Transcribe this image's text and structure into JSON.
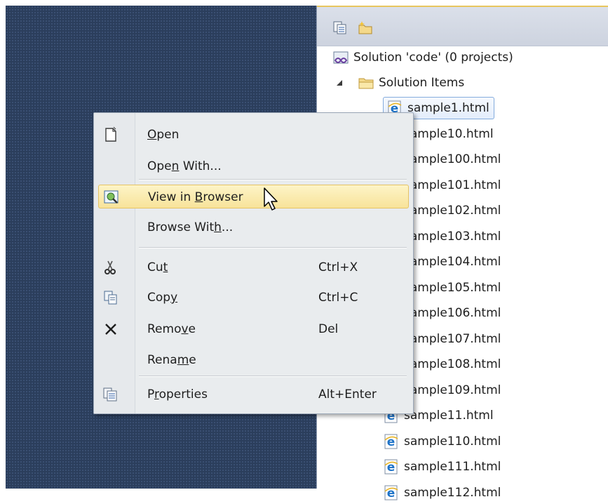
{
  "solution_explorer": {
    "solution_label": "Solution 'code' (0 projects)",
    "folder_label": "Solution Items",
    "files": [
      "sample1.html",
      "sample10.html",
      "sample100.html",
      "sample101.html",
      "sample102.html",
      "sample103.html",
      "sample104.html",
      "sample105.html",
      "sample106.html",
      "sample107.html",
      "sample108.html",
      "sample109.html",
      "sample11.html",
      "sample110.html",
      "sample111.html",
      "sample112.html"
    ]
  },
  "context_menu": {
    "items": [
      {
        "pre": "",
        "acc": "O",
        "post": "pen",
        "shortcut": "",
        "icon": "open-file-icon"
      },
      {
        "pre": "Ope",
        "acc": "n",
        "post": " With...",
        "shortcut": "",
        "icon": ""
      },
      {
        "pre": "View in ",
        "acc": "B",
        "post": "rowser",
        "shortcut": "",
        "icon": "view-in-browser-icon"
      },
      {
        "pre": "Browse Wit",
        "acc": "h",
        "post": "...",
        "shortcut": "",
        "icon": ""
      },
      {
        "pre": "Cu",
        "acc": "t",
        "post": "",
        "shortcut": "Ctrl+X",
        "icon": "scissors-icon"
      },
      {
        "pre": "Cop",
        "acc": "y",
        "post": "",
        "shortcut": "Ctrl+C",
        "icon": "copy-icon"
      },
      {
        "pre": "Remo",
        "acc": "v",
        "post": "e",
        "shortcut": "Del",
        "icon": "remove-icon"
      },
      {
        "pre": "Rena",
        "acc": "m",
        "post": "e",
        "shortcut": "",
        "icon": ""
      },
      {
        "pre": "P",
        "acc": "r",
        "post": "operties",
        "shortcut": "Alt+Enter",
        "icon": "properties-icon"
      }
    ]
  },
  "colors": {
    "accent_highlight": "#f8e39a",
    "dark_background": "#2b3e5c",
    "ie_icon_blue": "#1e73c8"
  }
}
